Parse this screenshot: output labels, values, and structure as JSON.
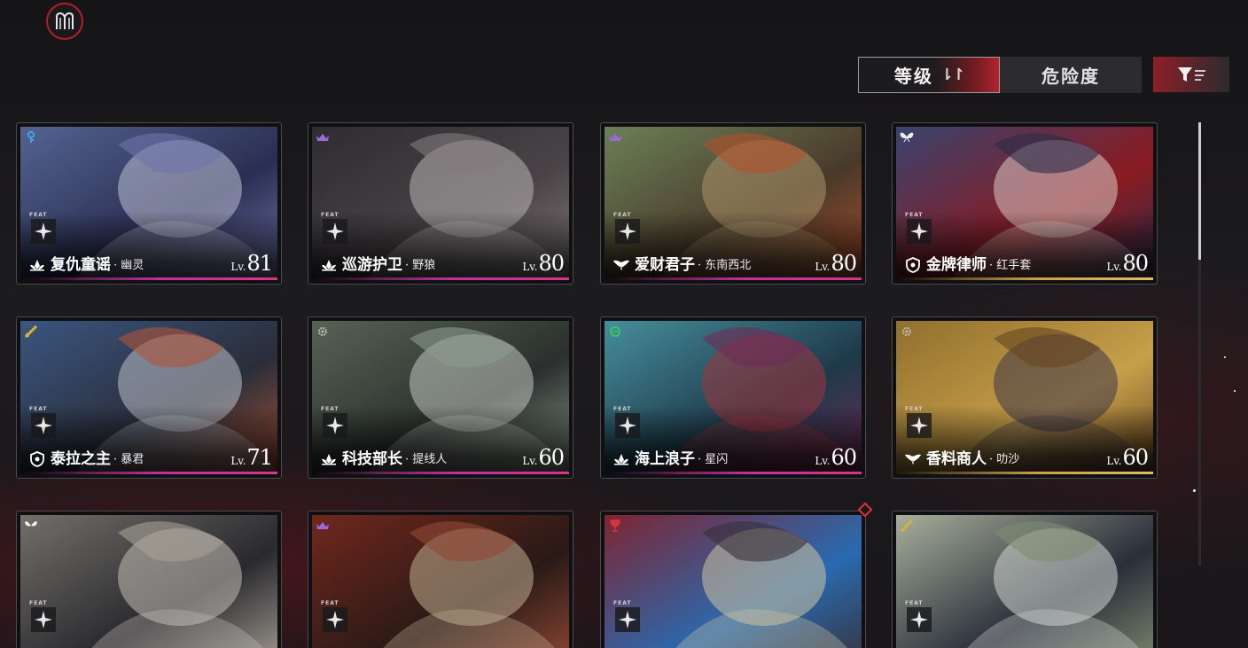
{
  "sort": {
    "level_label": "等级",
    "level_arrows": "⇂↾",
    "danger_label": "危险度"
  },
  "colors": {
    "accent": "#b0242d",
    "card_border": "#4b4a4e",
    "rank_line_pink": "#c2309e",
    "rank_line_gold": "#c8a24a"
  },
  "cards": [
    {
      "name": "复仇童谣",
      "sub": "· 幽灵",
      "lv_tag": "Lv.",
      "level": "81",
      "feat": "FEAT",
      "badge_icon": "key-icon",
      "class_icon": "lotus-icon",
      "rank": "pink",
      "palette": [
        "#5a6a9a",
        "#cfd3e6",
        "#2b2f52",
        "#7a7fb8"
      ]
    },
    {
      "name": "巡游护卫",
      "sub": "· 野狼",
      "lv_tag": "Lv.",
      "level": "80",
      "feat": "FEAT",
      "badge_icon": "crown-icon",
      "class_icon": "lotus-icon",
      "rank": "pink",
      "palette": [
        "#2a2a2e",
        "#c9c4c2",
        "#4a4447",
        "#8a8485"
      ]
    },
    {
      "name": "爱财君子",
      "sub": "· 东南西北",
      "lv_tag": "Lv.",
      "level": "80",
      "feat": "FEAT",
      "badge_icon": "crown-icon",
      "class_icon": "wings-icon",
      "rank": "pink",
      "palette": [
        "#6f8a5e",
        "#b8a074",
        "#4a3a2a",
        "#c2552e"
      ]
    },
    {
      "name": "金牌律师",
      "sub": "· 红手套",
      "lv_tag": "Lv.",
      "level": "80",
      "feat": "FEAT",
      "badge_icon": "butterfly-icon",
      "class_icon": "shield-icon",
      "rank": "gold",
      "palette": [
        "#2e4a7a",
        "#e8e2dc",
        "#8a1c22",
        "#1e2f50"
      ]
    },
    {
      "name": "泰拉之主",
      "sub": "· 暴君",
      "lv_tag": "Lv.",
      "level": "71",
      "feat": "FEAT",
      "badge_icon": "sword-icon",
      "class_icon": "shield-icon",
      "rank": "pink",
      "palette": [
        "#3e5b8a",
        "#cfd4dc",
        "#2a2e3a",
        "#c25a3a"
      ]
    },
    {
      "name": "科技部长",
      "sub": "· 提线人",
      "lv_tag": "Lv.",
      "level": "60",
      "feat": "FEAT",
      "badge_icon": "gear-icon",
      "class_icon": "lotus-icon",
      "rank": "pink",
      "palette": [
        "#5d6a58",
        "#d6dbd4",
        "#2c302e",
        "#9aa89a"
      ]
    },
    {
      "name": "海上浪子",
      "sub": "· 星闪",
      "lv_tag": "Lv.",
      "level": "60",
      "feat": "FEAT",
      "badge_icon": "ring-icon",
      "class_icon": "lotus-icon",
      "rank": "pink",
      "palette": [
        "#4c9aa6",
        "#b0343e",
        "#1e3a4a",
        "#7c2a5a"
      ]
    },
    {
      "name": "香料商人",
      "sub": "· 叻沙",
      "lv_tag": "Lv.",
      "level": "60",
      "feat": "FEAT",
      "badge_icon": "gear-icon",
      "class_icon": "wings-icon",
      "rank": "gold",
      "palette": [
        "#8a6a2a",
        "#2a2a4a",
        "#c8a04a",
        "#5a3a1a"
      ]
    },
    {
      "name": "",
      "sub": "",
      "lv_tag": "",
      "level": "",
      "feat": "FEAT",
      "badge_icon": "butterfly-icon",
      "class_icon": "",
      "rank": "none",
      "palette": [
        "#7d7a72",
        "#d8d2c8",
        "#2a2a2e",
        "#b8b0a4"
      ]
    },
    {
      "name": "",
      "sub": "",
      "lv_tag": "",
      "level": "",
      "feat": "FEAT",
      "badge_icon": "crown-icon",
      "class_icon": "",
      "rank": "none",
      "palette": [
        "#7a2a1e",
        "#d6c2a2",
        "#2a1a16",
        "#a0503a"
      ]
    },
    {
      "name": "",
      "sub": "",
      "lv_tag": "",
      "level": "",
      "feat": "FEAT",
      "badge_icon": "goblet-icon",
      "class_icon": "",
      "rank": "none",
      "palette": [
        "#8a1c22",
        "#e6d2a0",
        "#2a6ab0",
        "#3a2a2a"
      ]
    },
    {
      "name": "",
      "sub": "",
      "lv_tag": "",
      "level": "",
      "feat": "FEAT",
      "badge_icon": "sword-icon",
      "class_icon": "",
      "rank": "none",
      "palette": [
        "#b8c0a8",
        "#e8ece6",
        "#2a2e3a",
        "#8a9a7a"
      ]
    }
  ]
}
